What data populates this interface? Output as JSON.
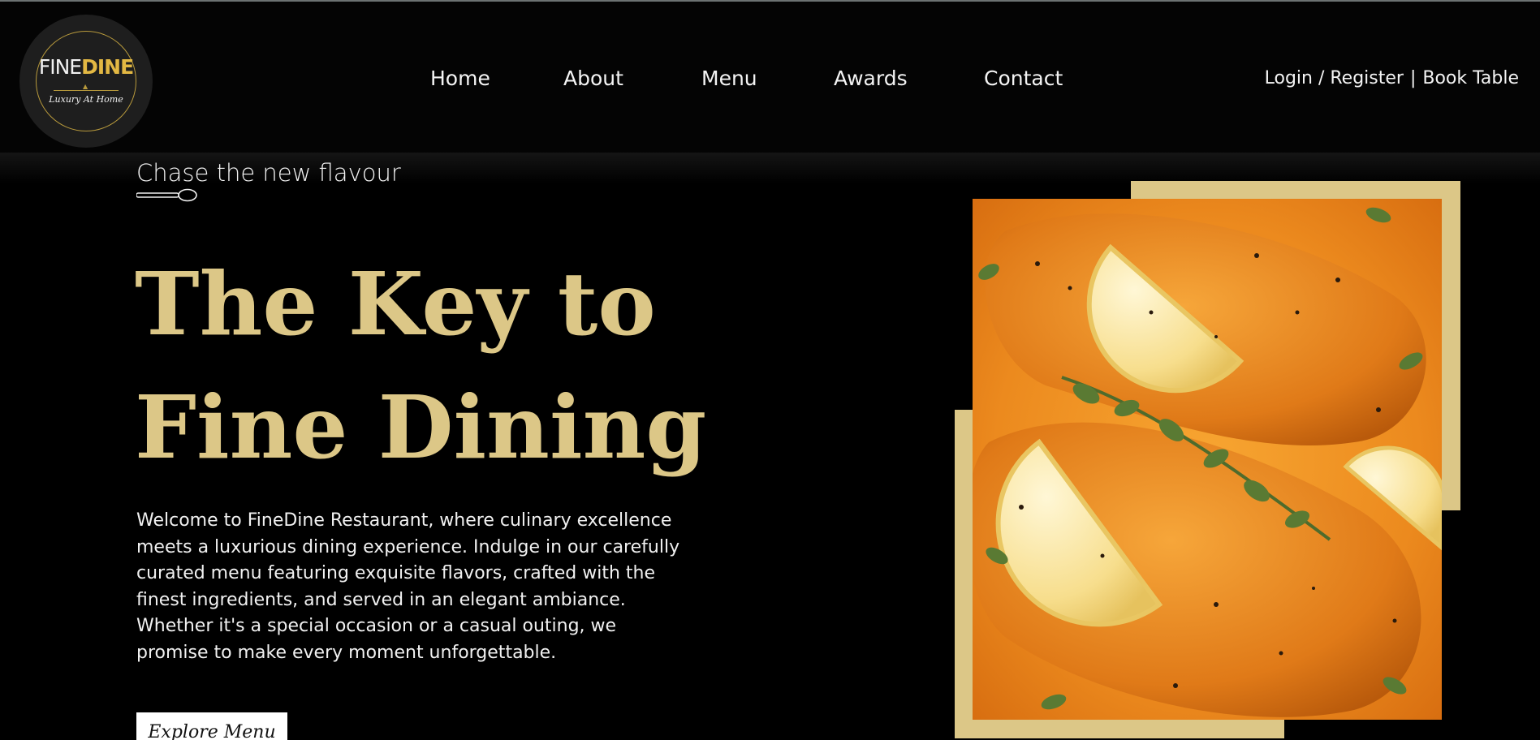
{
  "brand": {
    "name_part1": "FINE",
    "name_part2": "DINE",
    "tagline": "Luxury At Home",
    "accent_color": "#dcc787",
    "logo_gold": "#e3b843",
    "background": "#000000"
  },
  "nav": {
    "items": [
      {
        "label": "Home"
      },
      {
        "label": "About"
      },
      {
        "label": "Menu"
      },
      {
        "label": "Awards"
      },
      {
        "label": "Contact"
      }
    ],
    "login_label": "Login / Register",
    "separator": "|",
    "book_label": "Book Table"
  },
  "hero": {
    "tagline": "Chase the new flavour",
    "spoon_icon": "spoon-icon",
    "title_line1": "The Key to",
    "title_line2": "Fine Dining",
    "description": "Welcome to FineDine Restaurant, where culinary excellence meets a luxurious dining experience. Indulge in our carefully curated menu featuring exquisite flavors, crafted with the finest ingredients, and served in an elegant ambiance. Whether it's a special occasion or a casual outing, we promise to make every moment unforgettable.",
    "cta_label": "Explore Menu"
  }
}
